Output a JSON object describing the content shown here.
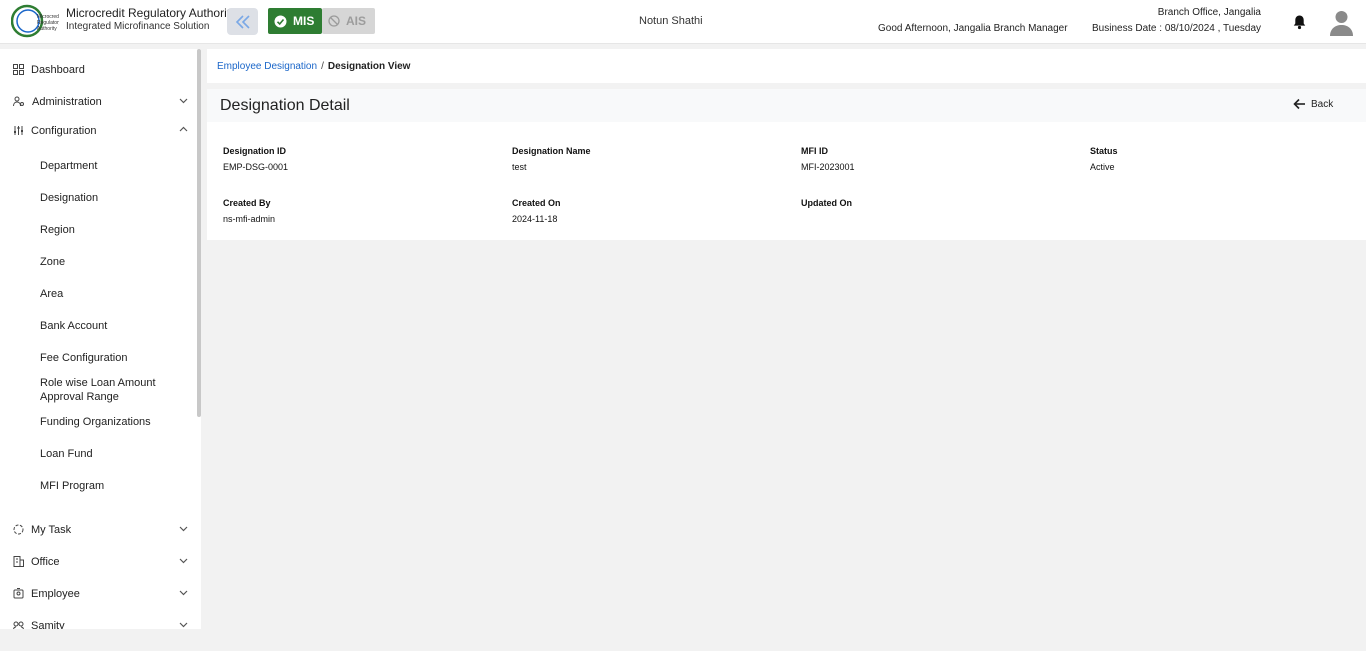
{
  "header": {
    "org_title": "Microcredit Regulatory Authority",
    "org_subtitle": "Integrated Microfinance Solution",
    "mode_active": "MIS",
    "mode_inactive": "AIS",
    "app_name": "Notun Shathi",
    "greeting": "Good Afternoon, Jangalia Branch Manager",
    "branch_office": "Branch Office, Jangalia",
    "business_date": "Business Date : 08/10/2024 , Tuesday",
    "accent_color": "#2e7d32",
    "link_color": "#1a66c9"
  },
  "sidebar": {
    "dashboard": "Dashboard",
    "administration": "Administration",
    "configuration": "Configuration",
    "config_items": [
      "Department",
      "Designation",
      "Region",
      "Zone",
      "Area",
      "Bank Account",
      "Fee Configuration",
      "Role wise Loan Amount Approval Range",
      "Funding Organizations",
      "Loan Fund",
      "MFI Program"
    ],
    "my_task": "My Task",
    "office": "Office",
    "employee": "Employee",
    "samity": "Samity"
  },
  "breadcrumb": {
    "parent": "Employee Designation",
    "separator": "/",
    "current": "Designation View"
  },
  "detail": {
    "title": "Designation Detail",
    "back_label": "Back",
    "fields": [
      {
        "label": "Designation ID",
        "value": "EMP-DSG-0001"
      },
      {
        "label": "Designation Name",
        "value": "test"
      },
      {
        "label": "MFI ID",
        "value": "MFI-2023001"
      },
      {
        "label": "Status",
        "value": "Active"
      },
      {
        "label": "Created By",
        "value": "ns-mfi-admin"
      },
      {
        "label": "Created On",
        "value": "2024-11-18"
      },
      {
        "label": "Updated On",
        "value": ""
      }
    ]
  }
}
